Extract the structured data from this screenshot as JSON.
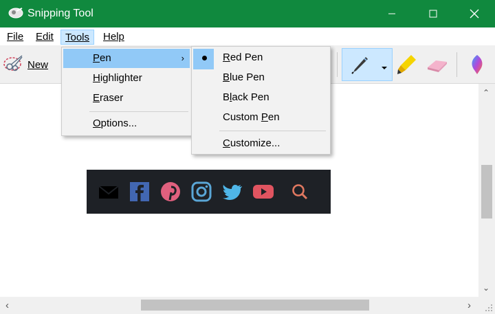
{
  "window": {
    "title": "Snipping Tool",
    "accent_color": "#10893e"
  },
  "menubar": {
    "file": "File",
    "edit": "Edit",
    "tools": "Tools",
    "help": "Help"
  },
  "toolbar": {
    "new_label": "New",
    "pen_icon": "pen-icon",
    "highlighter_icon": "highlighter-icon",
    "eraser_icon": "eraser-icon",
    "paint3d_icon": "paint3d-icon"
  },
  "tools_menu": {
    "items": [
      {
        "label": "Pen",
        "mnemonic": "P",
        "rest": "en",
        "has_submenu": true,
        "highlighted": true
      },
      {
        "label": "Highlighter",
        "mnemonic": "H",
        "rest": "ighlighter"
      },
      {
        "label": "Eraser",
        "mnemonic": "E",
        "rest": "raser"
      },
      {
        "label": "Options...",
        "mnemonic": "O",
        "rest": "ptions..."
      }
    ]
  },
  "pen_submenu": {
    "items": [
      {
        "label": "Red Pen",
        "pre": "",
        "mnemonic": "R",
        "rest": "ed Pen",
        "selected": true
      },
      {
        "label": "Blue Pen",
        "pre": "",
        "mnemonic": "B",
        "rest": "lue Pen"
      },
      {
        "label": "Black Pen",
        "pre": "B",
        "mnemonic": "l",
        "rest": "ack Pen"
      },
      {
        "label": "Custom Pen",
        "pre": "Custom ",
        "mnemonic": "P",
        "rest": "en"
      },
      {
        "label": "Customize...",
        "pre": "",
        "mnemonic": "C",
        "rest": "ustomize..."
      }
    ]
  },
  "canvas": {
    "social_icons": [
      "mail-icon",
      "facebook-icon",
      "pinterest-icon",
      "instagram-icon",
      "twitter-icon",
      "youtube-icon",
      "search-icon"
    ],
    "strip_color": "#1e2126"
  }
}
